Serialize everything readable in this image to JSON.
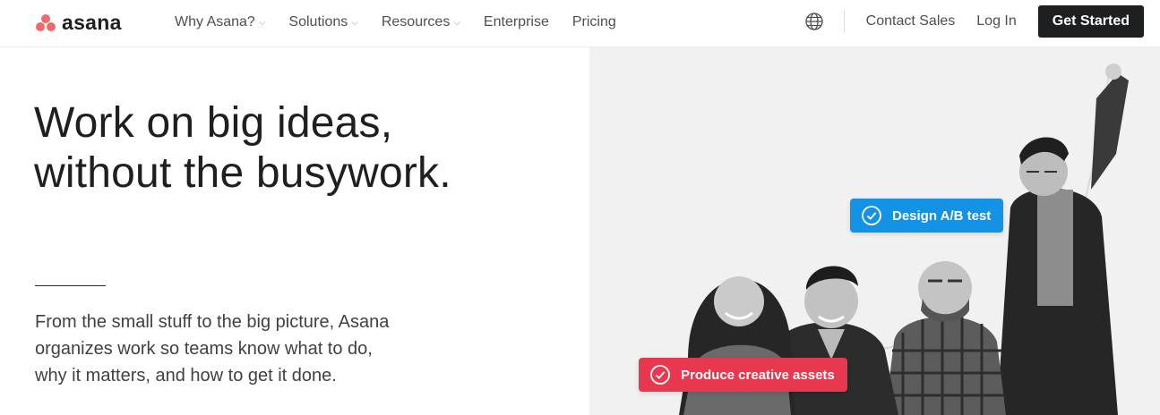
{
  "brand": {
    "name": "asana",
    "color": "#f06a6a"
  },
  "nav": {
    "links": [
      {
        "label": "Why Asana?",
        "dropdown": true
      },
      {
        "label": "Solutions",
        "dropdown": true
      },
      {
        "label": "Resources",
        "dropdown": true
      },
      {
        "label": "Enterprise",
        "dropdown": false
      },
      {
        "label": "Pricing",
        "dropdown": false
      }
    ],
    "chevron": "⌵",
    "language_icon": "globe-icon",
    "contact_sales": "Contact Sales",
    "login": "Log In",
    "get_started": "Get Started"
  },
  "hero": {
    "headline_line1": "Work on big ideas,",
    "headline_line2": "without the busywork.",
    "description": "From the small stuff to the big picture, Asana organizes work so teams know what to do, why it matters, and how to get it done.",
    "task_chips": [
      {
        "label": "Design A/B test",
        "color": "#1492e6",
        "icon": "check-circle-icon"
      },
      {
        "label": "Produce creative assets",
        "color": "#e8384f",
        "icon": "check-circle-icon"
      }
    ]
  }
}
